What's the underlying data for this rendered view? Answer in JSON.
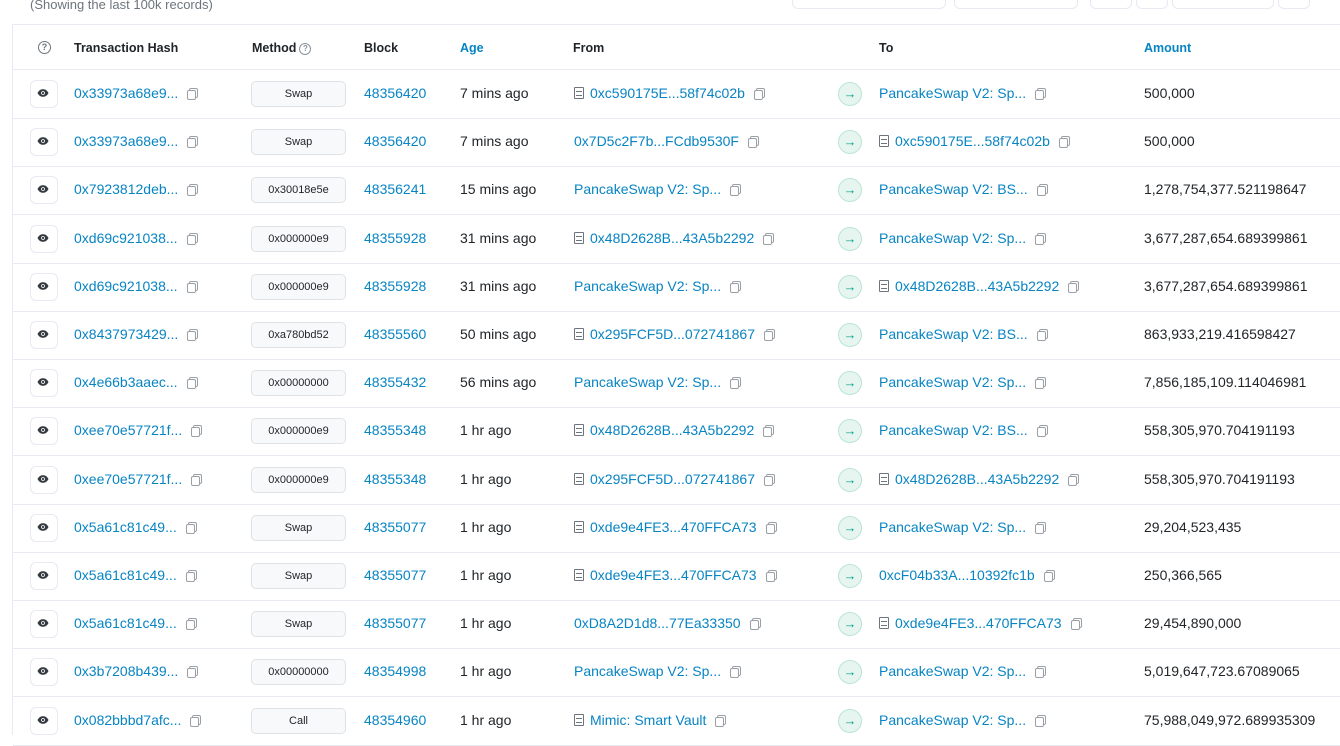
{
  "header": {
    "subtitle": "(Showing the last 100k records)"
  },
  "table": {
    "columns": {
      "hash": "Transaction Hash",
      "method": "Method",
      "block": "Block",
      "age": "Age",
      "from": "From",
      "to": "To",
      "amount": "Amount"
    },
    "rows": [
      {
        "hash": "0x33973a68e9...",
        "method": "Swap",
        "block": "48356420",
        "age": "7 mins ago",
        "from": "0xc590175E...58f74c02b",
        "from_contract": true,
        "to": "PancakeSwap V2: Sp...",
        "to_contract": false,
        "amount": "500,000"
      },
      {
        "hash": "0x33973a68e9...",
        "method": "Swap",
        "block": "48356420",
        "age": "7 mins ago",
        "from": "0x7D5c2F7b...FCdb9530F",
        "from_contract": false,
        "to": "0xc590175E...58f74c02b",
        "to_contract": true,
        "amount": "500,000"
      },
      {
        "hash": "0x7923812deb...",
        "method": "0x30018e5e",
        "block": "48356241",
        "age": "15 mins ago",
        "from": "PancakeSwap V2: Sp...",
        "from_contract": false,
        "to": "PancakeSwap V2: BS...",
        "to_contract": false,
        "amount": "1,278,754,377.521198647"
      },
      {
        "hash": "0xd69c921038...",
        "method": "0x000000e9",
        "block": "48355928",
        "age": "31 mins ago",
        "from": "0x48D2628B...43A5b2292",
        "from_contract": true,
        "to": "PancakeSwap V2: Sp...",
        "to_contract": false,
        "amount": "3,677,287,654.689399861"
      },
      {
        "hash": "0xd69c921038...",
        "method": "0x000000e9",
        "block": "48355928",
        "age": "31 mins ago",
        "from": "PancakeSwap V2: Sp...",
        "from_contract": false,
        "to": "0x48D2628B...43A5b2292",
        "to_contract": true,
        "amount": "3,677,287,654.689399861"
      },
      {
        "hash": "0x8437973429...",
        "method": "0xa780bd52",
        "block": "48355560",
        "age": "50 mins ago",
        "from": "0x295FCF5D...072741867",
        "from_contract": true,
        "to": "PancakeSwap V2: BS...",
        "to_contract": false,
        "amount": "863,933,219.416598427"
      },
      {
        "hash": "0x4e66b3aaec...",
        "method": "0x00000000",
        "block": "48355432",
        "age": "56 mins ago",
        "from": "PancakeSwap V2: Sp...",
        "from_contract": false,
        "to": "PancakeSwap V2: Sp...",
        "to_contract": false,
        "amount": "7,856,185,109.114046981"
      },
      {
        "hash": "0xee70e57721f...",
        "method": "0x000000e9",
        "block": "48355348",
        "age": "1 hr ago",
        "from": "0x48D2628B...43A5b2292",
        "from_contract": true,
        "to": "PancakeSwap V2: BS...",
        "to_contract": false,
        "amount": "558,305,970.704191193"
      },
      {
        "hash": "0xee70e57721f...",
        "method": "0x000000e9",
        "block": "48355348",
        "age": "1 hr ago",
        "from": "0x295FCF5D...072741867",
        "from_contract": true,
        "to": "0x48D2628B...43A5b2292",
        "to_contract": true,
        "amount": "558,305,970.704191193"
      },
      {
        "hash": "0x5a61c81c49...",
        "method": "Swap",
        "block": "48355077",
        "age": "1 hr ago",
        "from": "0xde9e4FE3...470FFCA73",
        "from_contract": true,
        "to": "PancakeSwap V2: Sp...",
        "to_contract": false,
        "amount": "29,204,523,435"
      },
      {
        "hash": "0x5a61c81c49...",
        "method": "Swap",
        "block": "48355077",
        "age": "1 hr ago",
        "from": "0xde9e4FE3...470FFCA73",
        "from_contract": true,
        "to": "0xcF04b33A...10392fc1b",
        "to_contract": false,
        "amount": "250,366,565"
      },
      {
        "hash": "0x5a61c81c49...",
        "method": "Swap",
        "block": "48355077",
        "age": "1 hr ago",
        "from": "0xD8A2D1d8...77Ea33350",
        "from_contract": false,
        "to": "0xde9e4FE3...470FFCA73",
        "to_contract": true,
        "amount": "29,454,890,000"
      },
      {
        "hash": "0x3b7208b439...",
        "method": "0x00000000",
        "block": "48354998",
        "age": "1 hr ago",
        "from": "PancakeSwap V2: Sp...",
        "from_contract": false,
        "to": "PancakeSwap V2: Sp...",
        "to_contract": false,
        "amount": "5,019,647,723.67089065"
      },
      {
        "hash": "0x082bbbd7afc...",
        "method": "Call",
        "block": "48354960",
        "age": "1 hr ago",
        "from": "Mimic: Smart Vault",
        "from_contract": true,
        "to": "PancakeSwap V2: Sp...",
        "to_contract": false,
        "amount": "75,988,049,972.689935309"
      }
    ]
  }
}
